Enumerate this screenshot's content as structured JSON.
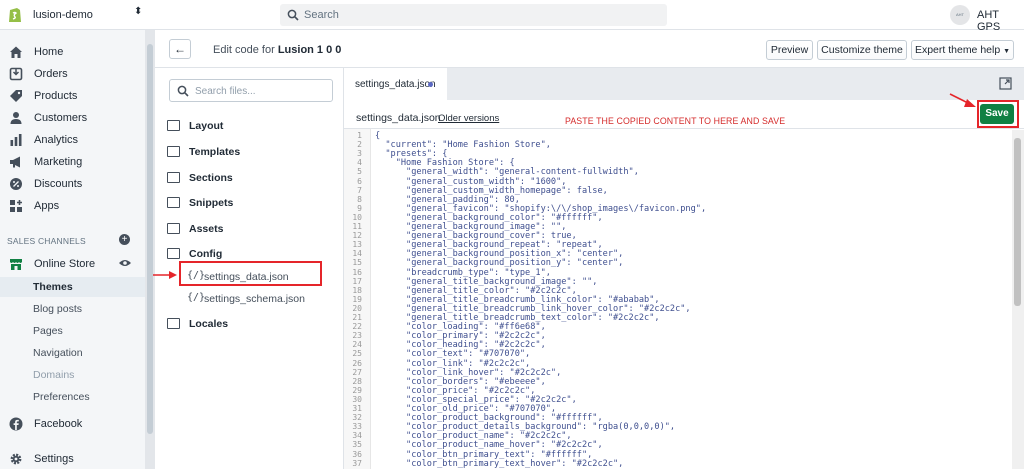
{
  "topbar": {
    "store_name": "lusion-demo",
    "search_placeholder": "Search",
    "avatar_text": "AHT",
    "user_name": "AHT GPS"
  },
  "sidebar": {
    "items": [
      {
        "label": "Home",
        "icon": "home-icon"
      },
      {
        "label": "Orders",
        "icon": "orders-icon"
      },
      {
        "label": "Products",
        "icon": "tag-icon"
      },
      {
        "label": "Customers",
        "icon": "person-icon"
      },
      {
        "label": "Analytics",
        "icon": "bar-chart-icon"
      },
      {
        "label": "Marketing",
        "icon": "megaphone-icon"
      },
      {
        "label": "Discounts",
        "icon": "discount-icon"
      },
      {
        "label": "Apps",
        "icon": "apps-icon"
      }
    ],
    "sales_channels_label": "SALES CHANNELS",
    "online_store": "Online Store",
    "online_store_sub": [
      "Themes",
      "Blog posts",
      "Pages",
      "Navigation",
      "Domains",
      "Preferences"
    ],
    "facebook": "Facebook",
    "settings": "Settings"
  },
  "header": {
    "edit_prefix": "Edit code for",
    "theme_name": "Lusion 1 0 0",
    "preview": "Preview",
    "customize": "Customize theme",
    "expert": "Expert theme help"
  },
  "files": {
    "search_placeholder": "Search files...",
    "folders": [
      "Layout",
      "Templates",
      "Sections",
      "Snippets",
      "Assets",
      "Config",
      "Locales"
    ],
    "config_files": [
      "settings_data.json",
      "settings_schema.json"
    ],
    "file_icon": "{/}"
  },
  "editor": {
    "tab_name": "settings_data.json",
    "file_name": "settings_data.json",
    "older_versions": "Older versions",
    "save": "Save",
    "note": "PASTE THE COPIED CONTENT TO HERE AND SAVE",
    "lines": [
      "{",
      "  \"current\": \"Home Fashion Store\",",
      "  \"presets\": {",
      "    \"Home Fashion Store\": {",
      "      \"general_width\": \"general-content-fullwidth\",",
      "      \"general_custom_width\": \"1600\",",
      "      \"general_custom_width_homepage\": false,",
      "      \"general_padding\": 80,",
      "      \"general_favicon\": \"shopify:\\/\\/shop_images\\/favicon.png\",",
      "      \"general_background_color\": \"#ffffff\",",
      "      \"general_background_image\": \"\",",
      "      \"general_background_cover\": true,",
      "      \"general_background_repeat\": \"repeat\",",
      "      \"general_background_position_x\": \"center\",",
      "      \"general_background_position_y\": \"center\",",
      "      \"breadcrumb_type\": \"type_1\",",
      "      \"general_title_background_image\": \"\",",
      "      \"general_title_color\": \"#2c2c2c\",",
      "      \"general_title_breadcrumb_link_color\": \"#ababab\",",
      "      \"general_title_breadcrumb_link_hover_color\": \"#2c2c2c\",",
      "      \"general_title_breadcrumb_text_color\": \"#2c2c2c\",",
      "      \"color_loading\": \"#ff6e68\",",
      "      \"color_primary\": \"#2c2c2c\",",
      "      \"color_heading\": \"#2c2c2c\",",
      "      \"color_text\": \"#707070\",",
      "      \"color_link\": \"#2c2c2c\",",
      "      \"color_link_hover\": \"#2c2c2c\",",
      "      \"color_borders\": \"#ebeeee\",",
      "      \"color_price\": \"#2c2c2c\",",
      "      \"color_special_price\": \"#2c2c2c\",",
      "      \"color_old_price\": \"#707070\",",
      "      \"color_product_background\": \"#ffffff\",",
      "      \"color_product_details_background\": \"rgba(0,0,0,0)\",",
      "      \"color_product_name\": \"#2c2c2c\",",
      "      \"color_product_name_hover\": \"#2c2c2c\",",
      "      \"color_btn_primary_text\": \"#ffffff\",",
      "      \"color_btn_primary_text_hover\": \"#2c2c2c\","
    ]
  },
  "colors": {
    "accent": "#108043",
    "highlight": "#e5252a",
    "active_nav": "#e6ecf1"
  }
}
